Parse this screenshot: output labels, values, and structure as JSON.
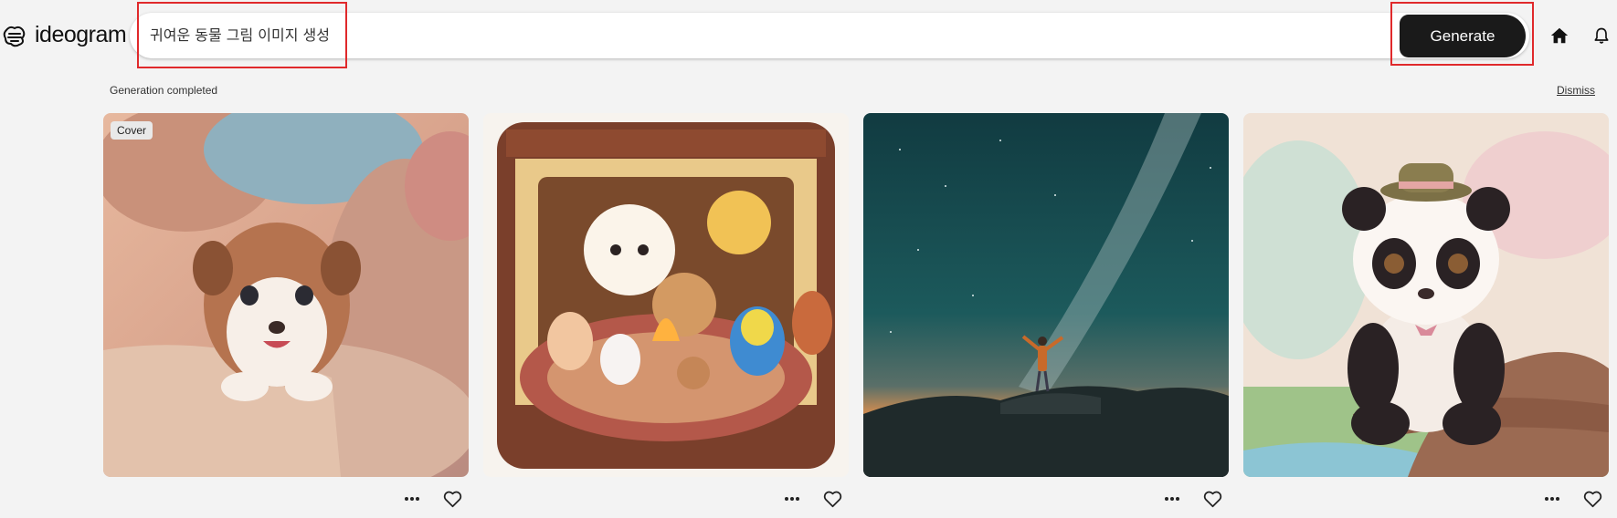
{
  "app": {
    "name": "ideogram"
  },
  "search": {
    "value": "귀여운 동물 그림 이미지 생성"
  },
  "toolbar": {
    "generate_label": "Generate"
  },
  "status": {
    "message": "Generation completed",
    "dismiss_label": "Dismiss"
  },
  "images": [
    {
      "badge": "Cover",
      "subject": "puppy on pillows"
    },
    {
      "subject": "baby animals around fireplace"
    },
    {
      "subject": "person under milky way"
    },
    {
      "subject": "baby panda with hat on branch"
    }
  ],
  "icons": [
    "logo-icon",
    "home-icon",
    "bell-icon",
    "more-icon",
    "heart-icon"
  ],
  "colors": {
    "highlight": "#e0292b",
    "button": "#1a1a1a",
    "background": "#f3f3f3"
  }
}
